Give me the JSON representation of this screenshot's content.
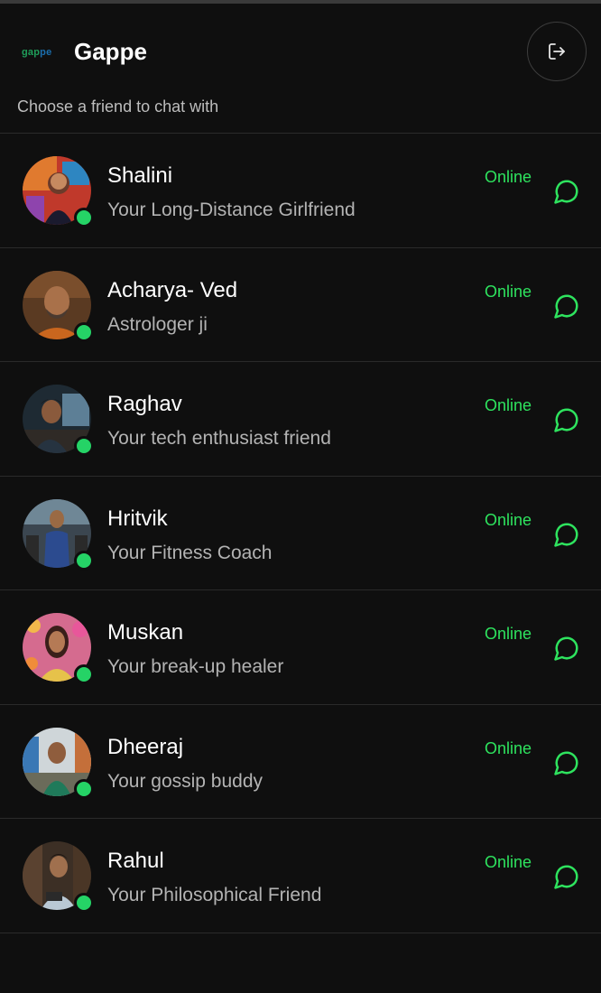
{
  "header": {
    "logo_part1": "gap",
    "logo_part2": "pe",
    "app_title": "Gappe",
    "subtitle": "Choose a friend to chat with",
    "logout_icon": "logout-icon"
  },
  "colors": {
    "background": "#0f0f0f",
    "online": "#2ee35e",
    "status_dot": "#25d366",
    "chat_icon": "#2ee35e"
  },
  "friends": [
    {
      "name": "Shalini",
      "description": "Your Long-Distance Girlfriend",
      "status": "Online"
    },
    {
      "name": "Acharya- Ved",
      "description": "Astrologer ji",
      "status": "Online"
    },
    {
      "name": "Raghav",
      "description": "Your tech enthusiast friend",
      "status": "Online"
    },
    {
      "name": "Hritvik",
      "description": "Your Fitness Coach",
      "status": "Online"
    },
    {
      "name": "Muskan",
      "description": "Your break-up healer",
      "status": "Online"
    },
    {
      "name": "Dheeraj",
      "description": "Your gossip buddy",
      "status": "Online"
    },
    {
      "name": "Rahul",
      "description": "Your Philosophical Friend",
      "status": "Online"
    }
  ]
}
